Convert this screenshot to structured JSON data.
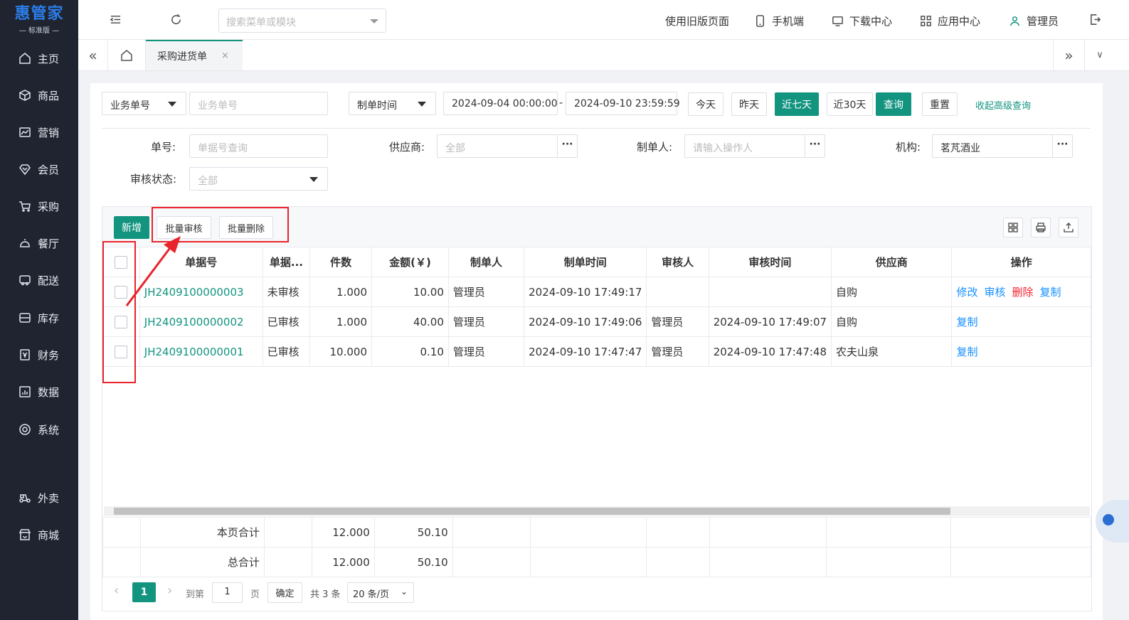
{
  "app": {
    "logo_name": "惠管家",
    "logo_edition": "— 标准版 —"
  },
  "sidebar": {
    "items": [
      {
        "label": "主页",
        "icon": "home-icon"
      },
      {
        "label": "商品",
        "icon": "box-icon"
      },
      {
        "label": "营销",
        "icon": "chart-icon"
      },
      {
        "label": "会员",
        "icon": "diamond-icon"
      },
      {
        "label": "采购",
        "icon": "cart-icon"
      },
      {
        "label": "餐厅",
        "icon": "cloche-icon"
      },
      {
        "label": "配送",
        "icon": "truck-icon"
      },
      {
        "label": "库存",
        "icon": "inbox-icon"
      },
      {
        "label": "财务",
        "icon": "yen-icon"
      },
      {
        "label": "数据",
        "icon": "bars-icon"
      },
      {
        "label": "系统",
        "icon": "gear-icon"
      },
      {
        "label": "外卖",
        "icon": "scooter-icon"
      },
      {
        "label": "商城",
        "icon": "shop-icon"
      }
    ]
  },
  "topbar": {
    "search_placeholder": "搜索菜单或模块",
    "old_page": "使用旧版页面",
    "mobile": "手机端",
    "download": "下载中心",
    "apps": "应用中心",
    "user": "管理员"
  },
  "tabs": {
    "active": "采购进货单"
  },
  "filters": {
    "field_select": "业务单号",
    "field_input_placeholder": "业务单号",
    "time_select": "制单时间",
    "start": "2024-09-04 00:00:00",
    "dash": "-",
    "end": "2024-09-10 23:59:59",
    "quick": [
      "今天",
      "昨天",
      "近七天",
      "近30天"
    ],
    "query": "查询",
    "reset": "重置",
    "collapse": "收起高级查询",
    "order_no_label": "单号:",
    "order_no_placeholder": "单据号查询",
    "supplier_label": "供应商:",
    "supplier_value": "全部",
    "creator_label": "制单人:",
    "creator_placeholder": "请输入操作人",
    "org_label": "机构:",
    "org_value": "茗芃酒业",
    "audit_label": "审核状态:",
    "audit_value": "全部"
  },
  "toolbar": {
    "add": "新增",
    "batch_audit": "批量审核",
    "batch_delete": "批量删除"
  },
  "table": {
    "headers": [
      "单据号",
      "单据...",
      "件数",
      "金额(￥)",
      "制单人",
      "制单时间",
      "审核人",
      "审核时间",
      "供应商",
      "操作"
    ],
    "rows": [
      {
        "no": "JH2409100000003",
        "status": "未审核",
        "qty": "1.000",
        "amount": "10.00",
        "creator": "管理员",
        "created": "2024-09-10 17:49:17",
        "auditor": "",
        "audited": "",
        "supplier": "自购",
        "ops": [
          "修改",
          "审核",
          "删除",
          "复制"
        ]
      },
      {
        "no": "JH2409100000002",
        "status": "已审核",
        "qty": "1.000",
        "amount": "40.00",
        "creator": "管理员",
        "created": "2024-09-10 17:49:06",
        "auditor": "管理员",
        "audited": "2024-09-10 17:49:07",
        "supplier": "自购",
        "ops": [
          "复制"
        ]
      },
      {
        "no": "JH2409100000001",
        "status": "已审核",
        "qty": "10.000",
        "amount": "0.10",
        "creator": "管理员",
        "created": "2024-09-10 17:47:47",
        "auditor": "管理员",
        "audited": "2024-09-10 17:47:48",
        "supplier": "农夫山泉",
        "ops": [
          "复制"
        ]
      }
    ],
    "page_total": {
      "label": "本页合计",
      "qty": "12.000",
      "amount": "50.10"
    },
    "grand_total": {
      "label": "总合计",
      "qty": "12.000",
      "amount": "50.10"
    }
  },
  "pager": {
    "current": "1",
    "goto": "到第",
    "goto_value": "1",
    "page_unit": "页",
    "confirm": "确定",
    "total": "共 3 条",
    "per_page": "20 条/页"
  },
  "colors": {
    "accent": "#12947f",
    "link": "#1890ff",
    "danger": "#f5222d",
    "annotation": "#e8232b"
  }
}
